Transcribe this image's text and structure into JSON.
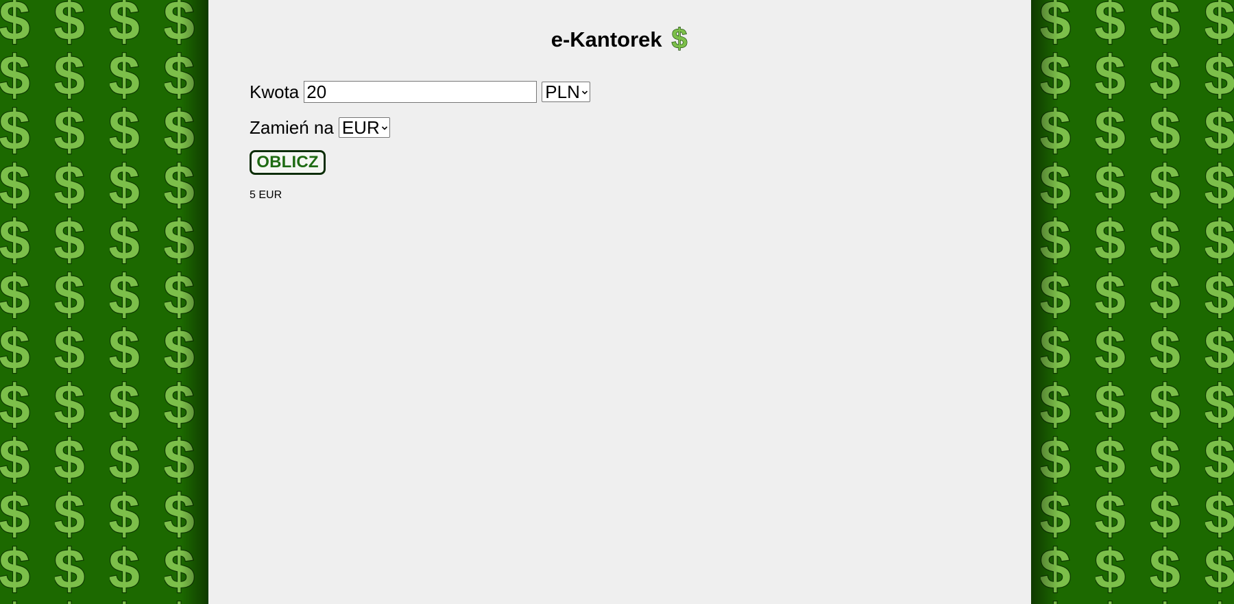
{
  "app": {
    "title": "e-Kantorek",
    "title_icon": "dollar-icon"
  },
  "form": {
    "amount_label": "Kwota",
    "amount_value": "20",
    "from_currency": "PLN",
    "target_label": "Zamień na",
    "to_currency": "EUR",
    "calculate_label": "OBLICZ"
  },
  "result": {
    "text": "5 EUR"
  },
  "background": {
    "pattern_icon": "dollar-icon",
    "colors": {
      "pattern_bg": "#1c6900",
      "dollar_fill": "#7cbf4a",
      "dollar_outline": "#0d3a00",
      "panel_bg": "#efefef",
      "button_text": "#1e6b12",
      "button_border": "#0b2d05"
    }
  }
}
